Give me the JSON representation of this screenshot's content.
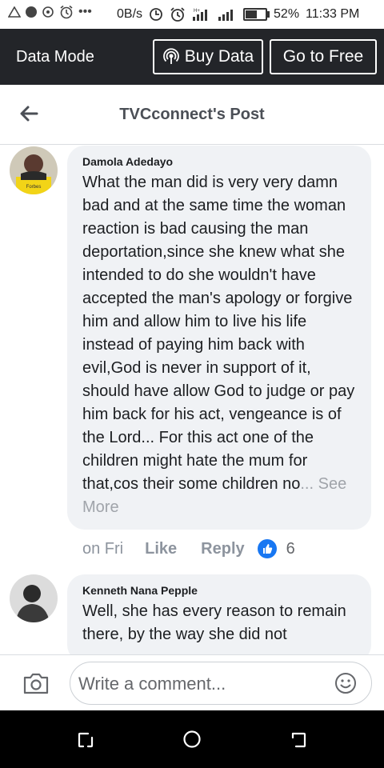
{
  "status_bar": {
    "network_speed": "0B/s",
    "battery": "52%",
    "time": "11:33 PM",
    "battery_level": 0.52
  },
  "data_mode_bar": {
    "label": "Data Mode",
    "buy_data": "Buy Data",
    "go_to_free": "Go to Free"
  },
  "header": {
    "title": "TVCconnect's Post"
  },
  "comments": [
    {
      "author": "Damola Adedayo",
      "avatar_label": "Forbes",
      "text": "What the man did is very very damn bad and at the same time the woman reaction is bad causing the man deportation,since she knew what she intended to do she wouldn't have accepted the man's apology or forgive him and allow him to live his life instead of paying him back with evil,God is never in support of it, should have allow God to judge or pay him back for his act, vengeance is of the Lord... For this act one of the children might hate the mum for that,cos their some children no",
      "ellipsis": "... ",
      "see_more": "See More",
      "time": "on Fri",
      "like": "Like",
      "reply": "Reply",
      "reaction_count": "6"
    },
    {
      "author": "Kenneth Nana Pepple",
      "text": "Well, she has every reason to remain there, by the way she did not"
    }
  ],
  "composer": {
    "placeholder": "Write a comment..."
  },
  "colors": {
    "data_bar": "#232529",
    "facebook_blue": "#1877f2",
    "bubble": "#f0f2f5"
  }
}
